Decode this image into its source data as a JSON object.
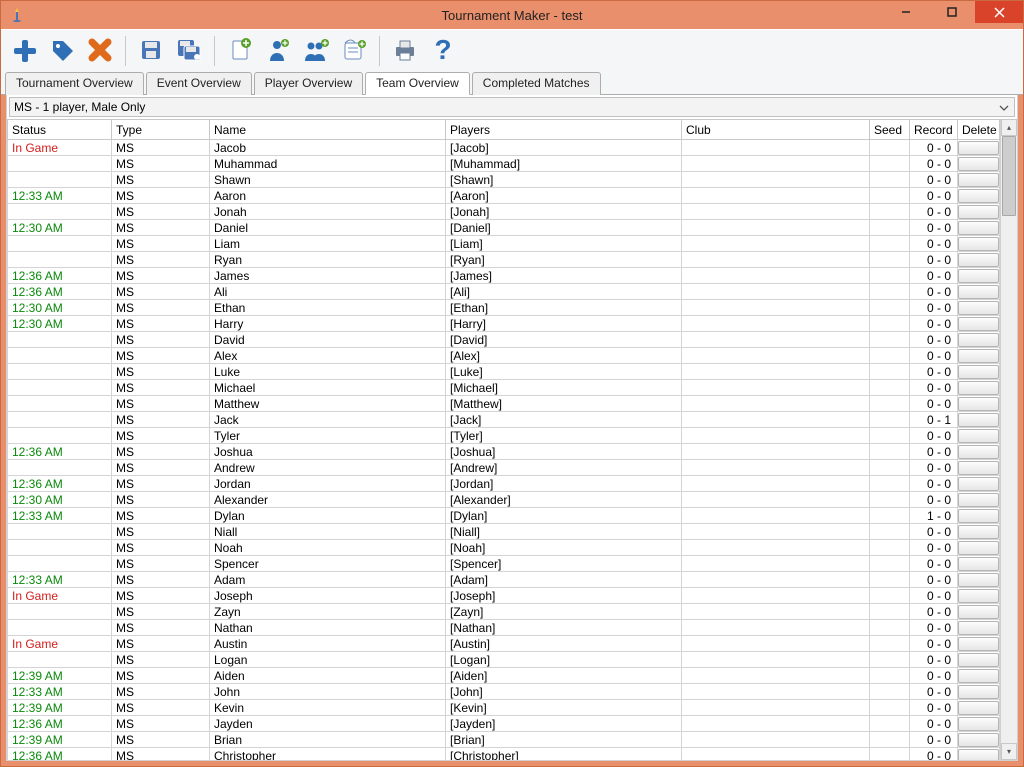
{
  "window": {
    "title": "Tournament Maker - test"
  },
  "toolbar": {
    "icons": [
      "add-icon",
      "tag-icon",
      "delete-icon",
      "sep",
      "save-icon",
      "save-all-icon",
      "sep",
      "new-doc-icon",
      "add-person-icon",
      "add-people-icon",
      "new-form-icon",
      "sep",
      "print-icon",
      "help-icon"
    ]
  },
  "tabs": [
    {
      "label": "Tournament Overview",
      "active": false
    },
    {
      "label": "Event Overview",
      "active": false
    },
    {
      "label": "Player Overview",
      "active": false
    },
    {
      "label": "Team Overview",
      "active": true
    },
    {
      "label": "Completed Matches",
      "active": false
    }
  ],
  "dropdown": {
    "selected": "MS - 1 player, Male Only"
  },
  "columns": [
    "Status",
    "Type",
    "Name",
    "Players",
    "Club",
    "Seed",
    "Record",
    "Delete"
  ],
  "rows": [
    {
      "status": "In Game",
      "statusClass": "ingame",
      "type": "MS",
      "name": "Jacob",
      "players": "[Jacob]",
      "club": "",
      "seed": "",
      "record": "0 - 0"
    },
    {
      "status": "",
      "statusClass": "",
      "type": "MS",
      "name": "Muhammad",
      "players": "[Muhammad]",
      "club": "",
      "seed": "",
      "record": "0 - 0"
    },
    {
      "status": "",
      "statusClass": "",
      "type": "MS",
      "name": "Shawn",
      "players": "[Shawn]",
      "club": "",
      "seed": "",
      "record": "0 - 0"
    },
    {
      "status": "12:33 AM",
      "statusClass": "time",
      "type": "MS",
      "name": "Aaron",
      "players": "[Aaron]",
      "club": "",
      "seed": "",
      "record": "0 - 0"
    },
    {
      "status": "",
      "statusClass": "",
      "type": "MS",
      "name": "Jonah",
      "players": "[Jonah]",
      "club": "",
      "seed": "",
      "record": "0 - 0"
    },
    {
      "status": "12:30 AM",
      "statusClass": "time",
      "type": "MS",
      "name": "Daniel",
      "players": "[Daniel]",
      "club": "",
      "seed": "",
      "record": "0 - 0"
    },
    {
      "status": "",
      "statusClass": "",
      "type": "MS",
      "name": "Liam",
      "players": "[Liam]",
      "club": "",
      "seed": "",
      "record": "0 - 0"
    },
    {
      "status": "",
      "statusClass": "",
      "type": "MS",
      "name": "Ryan",
      "players": "[Ryan]",
      "club": "",
      "seed": "",
      "record": "0 - 0"
    },
    {
      "status": "12:36 AM",
      "statusClass": "time",
      "type": "MS",
      "name": "James",
      "players": "[James]",
      "club": "",
      "seed": "",
      "record": "0 - 0"
    },
    {
      "status": "12:36 AM",
      "statusClass": "time",
      "type": "MS",
      "name": "Ali",
      "players": "[Ali]",
      "club": "",
      "seed": "",
      "record": "0 - 0"
    },
    {
      "status": "12:30 AM",
      "statusClass": "time",
      "type": "MS",
      "name": "Ethan",
      "players": "[Ethan]",
      "club": "",
      "seed": "",
      "record": "0 - 0"
    },
    {
      "status": "12:30 AM",
      "statusClass": "time",
      "type": "MS",
      "name": "Harry",
      "players": "[Harry]",
      "club": "",
      "seed": "",
      "record": "0 - 0"
    },
    {
      "status": "",
      "statusClass": "",
      "type": "MS",
      "name": "David",
      "players": "[David]",
      "club": "",
      "seed": "",
      "record": "0 - 0"
    },
    {
      "status": "",
      "statusClass": "",
      "type": "MS",
      "name": "Alex",
      "players": "[Alex]",
      "club": "",
      "seed": "",
      "record": "0 - 0"
    },
    {
      "status": "",
      "statusClass": "",
      "type": "MS",
      "name": "Luke",
      "players": "[Luke]",
      "club": "",
      "seed": "",
      "record": "0 - 0"
    },
    {
      "status": "",
      "statusClass": "",
      "type": "MS",
      "name": "Michael",
      "players": "[Michael]",
      "club": "",
      "seed": "",
      "record": "0 - 0"
    },
    {
      "status": "",
      "statusClass": "",
      "type": "MS",
      "name": "Matthew",
      "players": "[Matthew]",
      "club": "",
      "seed": "",
      "record": "0 - 0"
    },
    {
      "status": "",
      "statusClass": "",
      "type": "MS",
      "name": "Jack",
      "players": "[Jack]",
      "club": "",
      "seed": "",
      "record": "0 - 1"
    },
    {
      "status": "",
      "statusClass": "",
      "type": "MS",
      "name": "Tyler",
      "players": "[Tyler]",
      "club": "",
      "seed": "",
      "record": "0 - 0"
    },
    {
      "status": "12:36 AM",
      "statusClass": "time",
      "type": "MS",
      "name": "Joshua",
      "players": "[Joshua]",
      "club": "",
      "seed": "",
      "record": "0 - 0"
    },
    {
      "status": "",
      "statusClass": "",
      "type": "MS",
      "name": "Andrew",
      "players": "[Andrew]",
      "club": "",
      "seed": "",
      "record": "0 - 0"
    },
    {
      "status": "12:36 AM",
      "statusClass": "time",
      "type": "MS",
      "name": "Jordan",
      "players": "[Jordan]",
      "club": "",
      "seed": "",
      "record": "0 - 0"
    },
    {
      "status": "12:30 AM",
      "statusClass": "time",
      "type": "MS",
      "name": "Alexander",
      "players": "[Alexander]",
      "club": "",
      "seed": "",
      "record": "0 - 0"
    },
    {
      "status": "12:33 AM",
      "statusClass": "time",
      "type": "MS",
      "name": "Dylan",
      "players": "[Dylan]",
      "club": "",
      "seed": "",
      "record": "1 - 0"
    },
    {
      "status": "",
      "statusClass": "",
      "type": "MS",
      "name": "Niall",
      "players": "[Niall]",
      "club": "",
      "seed": "",
      "record": "0 - 0"
    },
    {
      "status": "",
      "statusClass": "",
      "type": "MS",
      "name": "Noah",
      "players": "[Noah]",
      "club": "",
      "seed": "",
      "record": "0 - 0"
    },
    {
      "status": "",
      "statusClass": "",
      "type": "MS",
      "name": "Spencer",
      "players": "[Spencer]",
      "club": "",
      "seed": "",
      "record": "0 - 0"
    },
    {
      "status": "12:33 AM",
      "statusClass": "time",
      "type": "MS",
      "name": "Adam",
      "players": "[Adam]",
      "club": "",
      "seed": "",
      "record": "0 - 0"
    },
    {
      "status": "In Game",
      "statusClass": "ingame",
      "type": "MS",
      "name": "Joseph",
      "players": "[Joseph]",
      "club": "",
      "seed": "",
      "record": "0 - 0"
    },
    {
      "status": "",
      "statusClass": "",
      "type": "MS",
      "name": "Zayn",
      "players": "[Zayn]",
      "club": "",
      "seed": "",
      "record": "0 - 0"
    },
    {
      "status": "",
      "statusClass": "",
      "type": "MS",
      "name": "Nathan",
      "players": "[Nathan]",
      "club": "",
      "seed": "",
      "record": "0 - 0"
    },
    {
      "status": "In Game",
      "statusClass": "ingame",
      "type": "MS",
      "name": "Austin",
      "players": "[Austin]",
      "club": "",
      "seed": "",
      "record": "0 - 0"
    },
    {
      "status": "",
      "statusClass": "",
      "type": "MS",
      "name": "Logan",
      "players": "[Logan]",
      "club": "",
      "seed": "",
      "record": "0 - 0"
    },
    {
      "status": "12:39 AM",
      "statusClass": "time",
      "type": "MS",
      "name": "Aiden",
      "players": "[Aiden]",
      "club": "",
      "seed": "",
      "record": "0 - 0"
    },
    {
      "status": "12:33 AM",
      "statusClass": "time",
      "type": "MS",
      "name": "John",
      "players": "[John]",
      "club": "",
      "seed": "",
      "record": "0 - 0"
    },
    {
      "status": "12:39 AM",
      "statusClass": "time",
      "type": "MS",
      "name": "Kevin",
      "players": "[Kevin]",
      "club": "",
      "seed": "",
      "record": "0 - 0"
    },
    {
      "status": "12:36 AM",
      "statusClass": "time",
      "type": "MS",
      "name": "Jayden",
      "players": "[Jayden]",
      "club": "",
      "seed": "",
      "record": "0 - 0"
    },
    {
      "status": "12:39 AM",
      "statusClass": "time",
      "type": "MS",
      "name": "Brian",
      "players": "[Brian]",
      "club": "",
      "seed": "",
      "record": "0 - 0"
    },
    {
      "status": "12:36 AM",
      "statusClass": "time",
      "type": "MS",
      "name": "Christopher",
      "players": "[Christopher]",
      "club": "",
      "seed": "",
      "record": "0 - 0"
    }
  ]
}
